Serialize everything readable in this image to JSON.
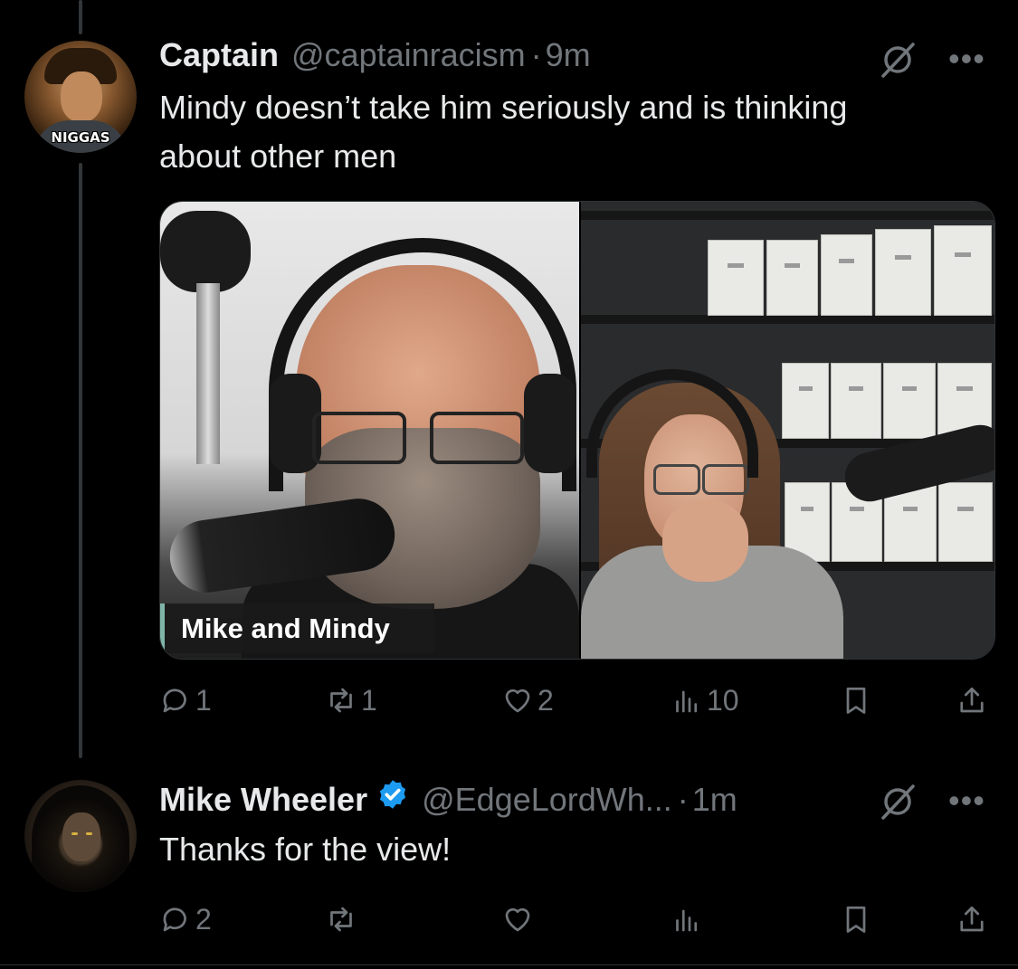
{
  "posts": [
    {
      "display_name": "Captain",
      "handle": "@captainracism",
      "separator": "·",
      "time": "9m",
      "text": "Mindy doesn’t take him seriously and is thinking about other men",
      "avatar_caption": "NIGGAS",
      "media_label": "Mike and Mindy",
      "stats": {
        "replies": "1",
        "reposts": "1",
        "likes": "2",
        "views": "10"
      }
    },
    {
      "display_name": "Mike Wheeler",
      "verified": true,
      "handle": "@EdgeLordWh...",
      "separator": "·",
      "time": "1m",
      "text": "Thanks for the view!",
      "stats": {
        "replies": "2",
        "reposts": "",
        "likes": "",
        "views": ""
      }
    }
  ],
  "icons": {
    "grok": "grok-icon",
    "more": "more-icon",
    "reply": "reply-icon",
    "repost": "repost-icon",
    "like": "heart-icon",
    "views": "views-icon",
    "bookmark": "bookmark-icon",
    "share": "share-icon"
  },
  "colors": {
    "background": "#000000",
    "text": "#e7e9ea",
    "secondary": "#71767b",
    "verified": "#1d9bf0"
  }
}
